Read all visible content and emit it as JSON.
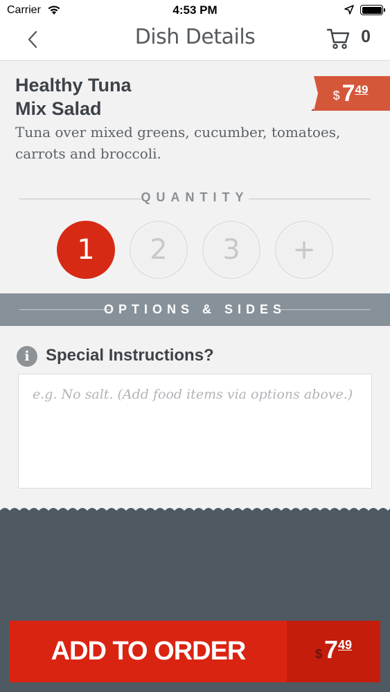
{
  "status_bar": {
    "carrier": "Carrier",
    "time": "4:53 PM"
  },
  "nav": {
    "title": "Dish Details",
    "cart_count": "0"
  },
  "dish": {
    "name": "Healthy Tuna\nMix Salad",
    "description": "Tuna over mixed greens, cucumber, tomatoes, carrots and broccoli.",
    "price": {
      "currency": "$",
      "dollars": "7",
      "cents": "49"
    }
  },
  "quantity": {
    "label": "QUANTITY",
    "options": [
      "1",
      "2",
      "3",
      "+"
    ],
    "selected": "1"
  },
  "options_bar": {
    "label": "OPTIONS & SIDES"
  },
  "special_instructions": {
    "label": "Special Instructions?",
    "placeholder": "e.g. No salt. (Add food items via options above.)",
    "value": ""
  },
  "add_to_order": {
    "label": "ADD TO ORDER",
    "currency": "$",
    "dollars": "7",
    "cents": "49"
  },
  "colors": {
    "accent_red": "#da2412",
    "price_tag": "#d5573a",
    "options_bar": "#879199",
    "bottom_bg": "#4e5962",
    "text_dark": "#3d4248"
  },
  "icons": {
    "back": "chevron-left-icon",
    "cart": "cart-icon",
    "info": "info-icon",
    "wifi": "wifi-icon",
    "location": "location-arrow-icon",
    "battery": "battery-icon"
  }
}
